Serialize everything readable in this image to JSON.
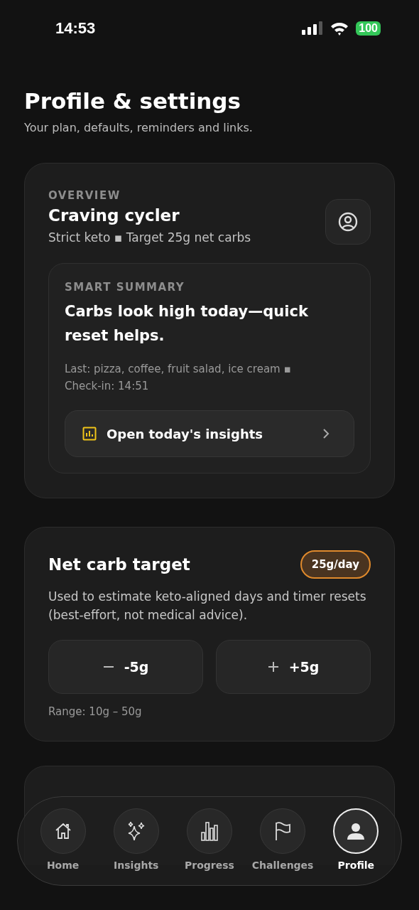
{
  "status_bar": {
    "time": "14:53",
    "battery": "100"
  },
  "header": {
    "title": "Profile & settings",
    "subtitle": "Your plan, defaults, reminders and links."
  },
  "overview": {
    "label": "OVERVIEW",
    "name": "Craving cycler",
    "plan": "Strict keto ▪ Target 25g net carbs",
    "summary": {
      "label": "SMART SUMMARY",
      "headline": "Carbs look high today—quick reset helps.",
      "meta": "Last: pizza, coffee, fruit salad, ice cream ▪ Check-in: 14:51",
      "action": "Open today's insights"
    }
  },
  "carb_target": {
    "title": "Net carb target",
    "badge": "25g/day",
    "description": "Used to estimate keto-aligned days and timer resets (best-effort, not medical advice).",
    "buttons": [
      {
        "kind": "minus",
        "label": "-5g"
      },
      {
        "kind": "plus",
        "label": "+5g"
      }
    ],
    "range": "Range: 10g – 50g"
  },
  "nav": [
    {
      "kind": "home",
      "label": "Home",
      "selected": false
    },
    {
      "kind": "insights",
      "label": "Insights",
      "selected": false
    },
    {
      "kind": "progress",
      "label": "Progress",
      "selected": false
    },
    {
      "kind": "challenges",
      "label": "Challenges",
      "selected": false
    },
    {
      "kind": "profile",
      "label": "Profile",
      "selected": true
    }
  ]
}
